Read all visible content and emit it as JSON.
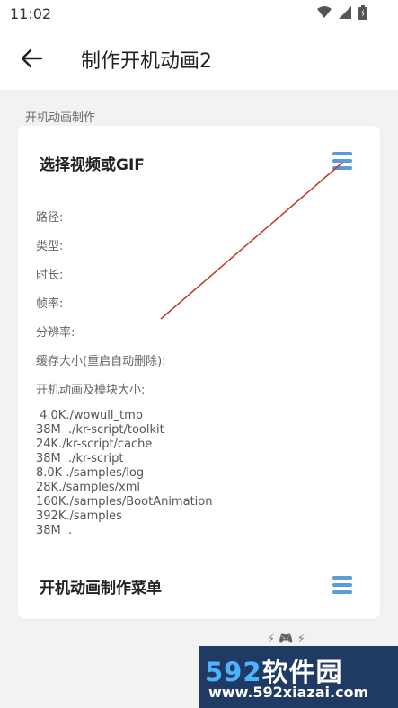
{
  "status": {
    "time": "11:02"
  },
  "appbar": {
    "title": "制作开机动画2"
  },
  "section": {
    "label": "开机动画制作"
  },
  "card": {
    "title": "选择视频或GIF",
    "fields": {
      "path": "路径:",
      "type": "类型:",
      "duration": "时长:",
      "framerate": "帧率:",
      "resolution": "分辨率:",
      "cache": "缓存大小(重启自动删除):",
      "module": "开机动画及模块大小:"
    },
    "usage": [
      " 4.0K./wowull_tmp",
      "38M  ./kr-script/toolkit",
      "24K./kr-script/cache",
      "38M  ./kr-script",
      "8.0K ./samples/log",
      "28K./samples/xml",
      "160K./samples/BootAnimation",
      "392K./samples",
      "38M  ."
    ],
    "menu_title": "开机动画制作菜单"
  },
  "watermark": {
    "brand_num": "592",
    "brand_text": "软件园",
    "url": "www.592xiazai.com"
  },
  "colors": {
    "accent": "#5b9bd9",
    "arrow": "#c0392b"
  }
}
